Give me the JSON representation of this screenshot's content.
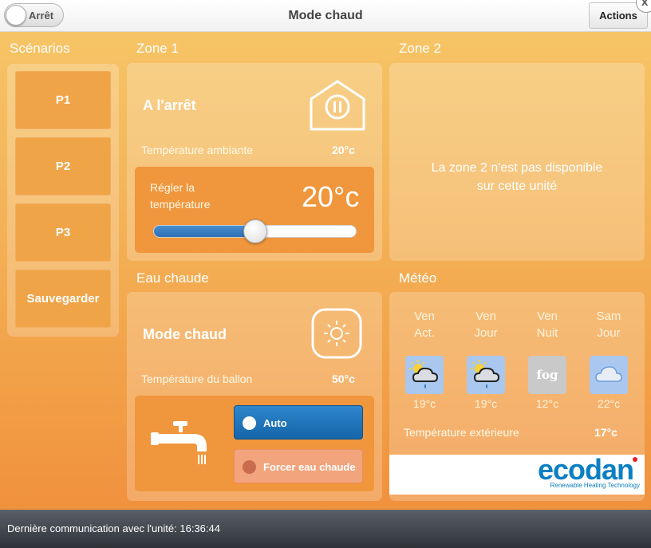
{
  "header": {
    "power_label": "Arrêt",
    "title": "Mode chaud",
    "actions_label": "Actions",
    "close_label": "x"
  },
  "scenarios": {
    "title": "Scénarios",
    "items": [
      "P1",
      "P2",
      "P3",
      "Sauvegarder"
    ]
  },
  "zone1": {
    "title": "Zone 1",
    "status": "A l'arrêt",
    "ambient_label": "Température ambiante",
    "ambient_value": "20°c",
    "setpoint_label": "Régler la température",
    "setpoint_value": "20°c",
    "slider_fraction": 0.5
  },
  "zone2": {
    "title": "Zone 2",
    "message_line1": "La zone 2 n'est pas disponible",
    "message_line2": "sur cette unité"
  },
  "hot_water": {
    "title": "Eau chaude",
    "status": "Mode chaud",
    "tank_label": "Température du ballon",
    "tank_value": "50°c",
    "auto_label": "Auto",
    "force_label": "Forcer eau chaude"
  },
  "weather": {
    "title": "Météo",
    "columns": [
      {
        "day": "Ven",
        "period": "Act.",
        "icon": "partly-cloudy-rain-icon",
        "temp": "19°c"
      },
      {
        "day": "Ven",
        "period": "Jour",
        "icon": "partly-cloudy-rain-icon",
        "temp": "19°c"
      },
      {
        "day": "Ven",
        "period": "Nuit",
        "icon": "fog-icon",
        "icon_text": "fog",
        "temp": "12°c"
      },
      {
        "day": "Sam",
        "period": "Jour",
        "icon": "cloud-icon",
        "temp": "22°c"
      }
    ],
    "outdoor_label": "Température extérieure",
    "outdoor_value": "17°c"
  },
  "brand": {
    "name": "ecodan",
    "tagline": "Renewable Heating Technology",
    "color": "#0b7fc2",
    "accent": "#e31e24"
  },
  "footer": {
    "text": "Dernière communication avec l'unité: 16:36:44"
  },
  "colors": {
    "primary_blue": "#1f74bb",
    "orange_accent": "#f0963c"
  }
}
